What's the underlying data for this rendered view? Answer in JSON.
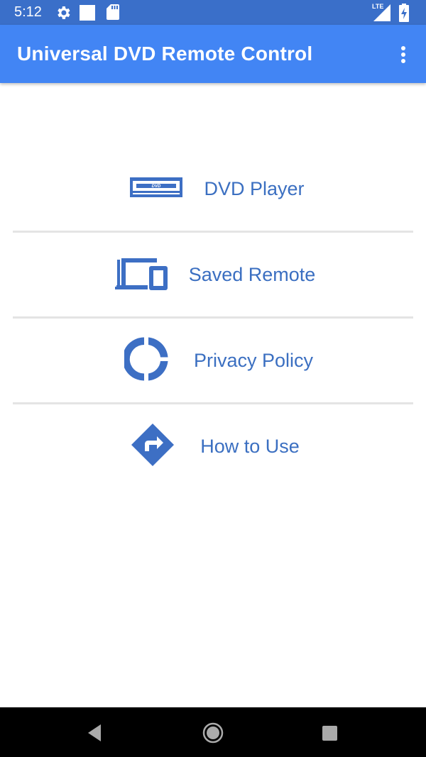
{
  "status_bar": {
    "time": "5:12",
    "network_label": "LTE",
    "icons": [
      "settings-icon",
      "square-icon",
      "sd-card-icon",
      "lte-signal-icon",
      "battery-icon"
    ]
  },
  "app_bar": {
    "title": "Universal DVD Remote Control",
    "overflow_icon": "more-vert-icon"
  },
  "menu": {
    "items": [
      {
        "label": "DVD Player",
        "icon": "dvd-player-icon",
        "icon_text": "DVD"
      },
      {
        "label": "Saved Remote",
        "icon": "devices-icon"
      },
      {
        "label": "Privacy Policy",
        "icon": "donut-icon"
      },
      {
        "label": "How to Use",
        "icon": "directions-icon"
      }
    ]
  },
  "nav_bar": {
    "icons": [
      "back-icon",
      "home-icon",
      "recents-icon"
    ]
  },
  "colors": {
    "status_bar": "#3a6fc9",
    "app_bar": "#4285f4",
    "accent_text": "#3b6fc1",
    "icon": "#3d6fc4",
    "divider": "#e4e4e4",
    "nav_bar": "#000000"
  }
}
